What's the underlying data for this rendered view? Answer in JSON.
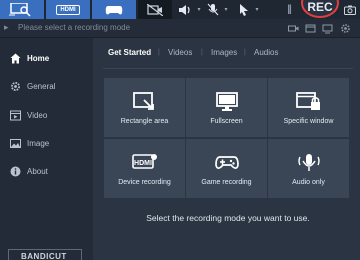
{
  "toolbar": {
    "hdmi_label": "HDMI",
    "rec_label": "REC"
  },
  "status": {
    "message": "Please select a recording mode"
  },
  "sidebar": {
    "items": [
      {
        "label": "Home",
        "icon": "home-icon"
      },
      {
        "label": "General",
        "icon": "gear-icon"
      },
      {
        "label": "Video",
        "icon": "video-icon"
      },
      {
        "label": "Image",
        "icon": "image-icon"
      },
      {
        "label": "About",
        "icon": "info-icon"
      }
    ],
    "brand": "BANDICUT"
  },
  "tabs": [
    "Get Started",
    "Videos",
    "Images",
    "Audios"
  ],
  "modes": [
    {
      "label": "Rectangle area",
      "icon": "rectangle-area-icon"
    },
    {
      "label": "Fullscreen",
      "icon": "monitor-icon"
    },
    {
      "label": "Specific window",
      "icon": "window-lock-icon"
    },
    {
      "label": "Device recording",
      "icon": "hdmi-icon"
    },
    {
      "label": "Game recording",
      "icon": "gamepad-icon"
    },
    {
      "label": "Audio only",
      "icon": "microphone-icon"
    }
  ],
  "hint": "Select the recording mode you want to use.",
  "colors": {
    "accent": "#3a6fbf",
    "rec_ring": "#e04040",
    "tile": "#3a4656",
    "background": "#2a3442"
  }
}
